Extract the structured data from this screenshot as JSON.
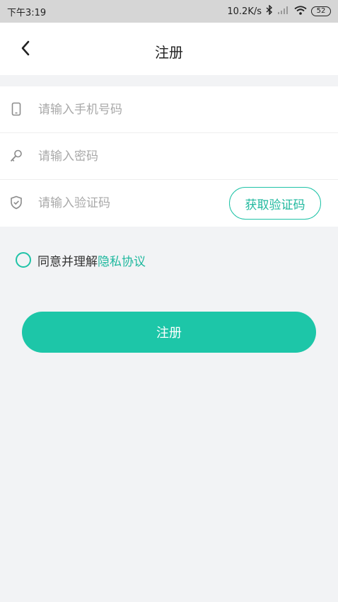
{
  "status_bar": {
    "time": "下午3:19",
    "network_speed": "10.2K/s",
    "bluetooth_icon": "bluetooth-icon",
    "signal_icon": "signal-icon",
    "wifi_icon": "wifi-icon",
    "battery": "52"
  },
  "header": {
    "back_icon": "chevron-left-icon",
    "title": "注册"
  },
  "form": {
    "phone": {
      "icon": "phone-icon",
      "placeholder": "请输入手机号码",
      "value": ""
    },
    "password": {
      "icon": "key-icon",
      "placeholder": "请输入密码",
      "value": ""
    },
    "code": {
      "icon": "shield-icon",
      "placeholder": "请输入验证码",
      "value": "",
      "button_label": "获取验证码"
    }
  },
  "agreement": {
    "text": "同意并理解",
    "link": "隐私协议",
    "checked": false
  },
  "submit": {
    "label": "注册"
  },
  "colors": {
    "accent": "#1dc6a8",
    "background": "#f2f3f5",
    "placeholder": "#a9a9a9"
  }
}
